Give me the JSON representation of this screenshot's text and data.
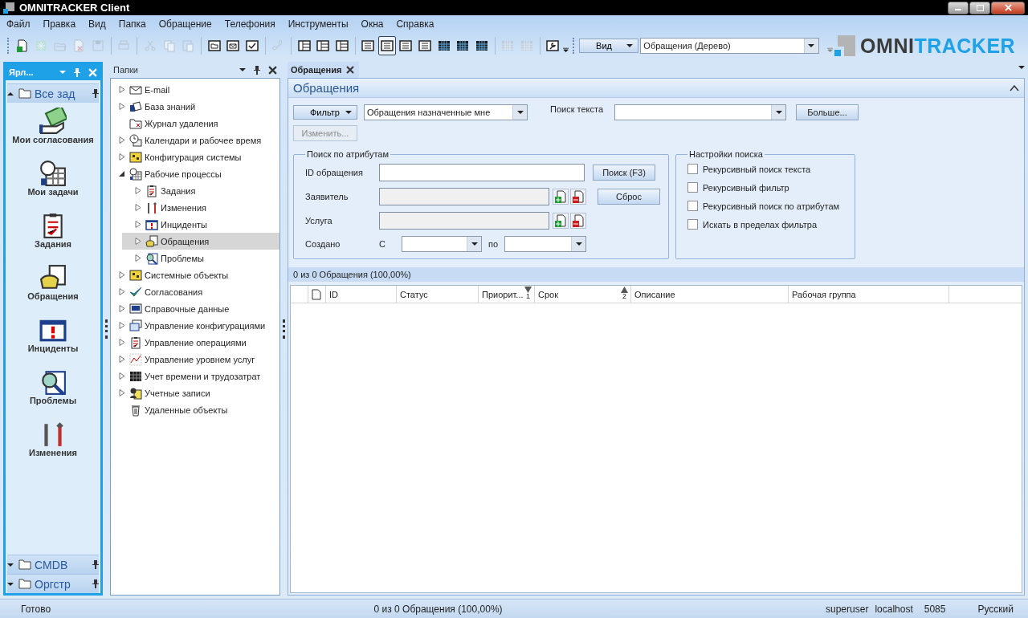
{
  "window": {
    "title": "OMNITRACKER Client"
  },
  "menu": [
    "Файл",
    "Правка",
    "Вид",
    "Папка",
    "Обращение",
    "Телефония",
    "Инструменты",
    "Окна",
    "Справка"
  ],
  "toolbar": [
    {
      "kind": "new",
      "disabled": false
    },
    {
      "kind": "star",
      "disabled": true
    },
    {
      "kind": "open",
      "disabled": true
    },
    {
      "kind": "delete",
      "disabled": true
    },
    {
      "kind": "save",
      "disabled": true
    },
    {
      "kind": "sep"
    },
    {
      "kind": "print",
      "disabled": true
    },
    {
      "kind": "sep"
    },
    {
      "kind": "cut",
      "disabled": true
    },
    {
      "kind": "copy",
      "disabled": true
    },
    {
      "kind": "paste",
      "disabled": true
    },
    {
      "kind": "sep"
    },
    {
      "kind": "folderwin",
      "disabled": false
    },
    {
      "kind": "mailwin",
      "disabled": false
    },
    {
      "kind": "checkwin",
      "disabled": false
    },
    {
      "kind": "sep"
    },
    {
      "kind": "phone",
      "disabled": true
    },
    {
      "kind": "sep"
    },
    {
      "kind": "layout",
      "disabled": false
    },
    {
      "kind": "layout",
      "disabled": false
    },
    {
      "kind": "layout",
      "disabled": false
    },
    {
      "kind": "sep"
    },
    {
      "kind": "list",
      "disabled": false
    },
    {
      "kind": "list",
      "disabled": false,
      "pressed": true
    },
    {
      "kind": "list",
      "disabled": false
    },
    {
      "kind": "list",
      "disabled": false
    },
    {
      "kind": "grid",
      "disabled": false
    },
    {
      "kind": "grid",
      "disabled": false
    },
    {
      "kind": "grid",
      "disabled": false
    },
    {
      "kind": "sep"
    },
    {
      "kind": "grid",
      "disabled": true
    },
    {
      "kind": "grid",
      "disabled": true
    },
    {
      "kind": "sep"
    },
    {
      "kind": "wrench",
      "disabled": false
    }
  ],
  "view_button": "Вид",
  "view_combo": "Обращения (Дерево)",
  "logo": {
    "dark": "OMNI",
    "accent": "TRACKER"
  },
  "shortcuts_panel": {
    "title": "Ярл...",
    "top_group": "Все зад",
    "items": [
      {
        "kind": "approval",
        "label": "Мои согласования"
      },
      {
        "kind": "calendar",
        "label": "Мои задачи"
      },
      {
        "kind": "clipboard",
        "label": "Задания"
      },
      {
        "kind": "phone",
        "label": "Обращения"
      },
      {
        "kind": "alert",
        "label": "Инциденты"
      },
      {
        "kind": "search",
        "label": "Проблемы"
      },
      {
        "kind": "tools",
        "label": "Изменения"
      }
    ],
    "bottom_groups": [
      "CMDB",
      "Оргстр"
    ]
  },
  "folders_panel": {
    "title": "Папки",
    "items": [
      {
        "kind": "mail",
        "label": "E-mail",
        "expandable": true,
        "expanded": false,
        "selected": false
      },
      {
        "kind": "book",
        "label": "База знаний",
        "expandable": true,
        "expanded": false,
        "selected": false
      },
      {
        "kind": "folderx",
        "label": "Журнал удаления",
        "expandable": false,
        "expanded": false,
        "selected": false
      },
      {
        "kind": "clock",
        "label": "Календари и рабочее время",
        "expandable": true,
        "expanded": false,
        "selected": false
      },
      {
        "kind": "config",
        "label": "Конфигурация системы",
        "expandable": true,
        "expanded": false,
        "selected": false
      },
      {
        "kind": "calendar",
        "label": "Рабочие процессы",
        "expandable": true,
        "expanded": true,
        "selected": false,
        "children": [
          {
            "kind": "clipboard",
            "label": "Задания",
            "expandable": true,
            "expanded": false,
            "selected": false
          },
          {
            "kind": "tools",
            "label": "Изменения",
            "expandable": true,
            "expanded": false,
            "selected": false
          },
          {
            "kind": "alert",
            "label": "Инциденты",
            "expandable": true,
            "expanded": false,
            "selected": false
          },
          {
            "kind": "phone",
            "label": "Обращения",
            "expandable": true,
            "expanded": false,
            "selected": true
          },
          {
            "kind": "search",
            "label": "Проблемы",
            "expandable": true,
            "expanded": false,
            "selected": false
          }
        ]
      },
      {
        "kind": "config",
        "label": "Системные объекты",
        "expandable": true,
        "expanded": false,
        "selected": false
      },
      {
        "kind": "check",
        "label": "Согласования",
        "expandable": true,
        "expanded": false,
        "selected": false
      },
      {
        "kind": "screen",
        "label": "Справочные данные",
        "expandable": true,
        "expanded": false,
        "selected": false
      },
      {
        "kind": "stack",
        "label": "Управление конфигурациями",
        "expandable": true,
        "expanded": false,
        "selected": false
      },
      {
        "kind": "clipboard",
        "label": "Управление операциями",
        "expandable": true,
        "expanded": false,
        "selected": false
      },
      {
        "kind": "chart",
        "label": "Управление уровнем услуг",
        "expandable": true,
        "expanded": false,
        "selected": false
      },
      {
        "kind": "grid",
        "label": "Учет времени и трудозатрат",
        "expandable": true,
        "expanded": false,
        "selected": false
      },
      {
        "kind": "users",
        "label": "Учетные записи",
        "expandable": true,
        "expanded": false,
        "selected": false
      },
      {
        "kind": "trash",
        "label": "Удаленные объекты",
        "expandable": false,
        "expanded": false,
        "selected": false
      }
    ]
  },
  "tabs": [
    {
      "label": "Обращения",
      "selected": true
    }
  ],
  "view": {
    "title": "Обращения",
    "filter_button": "Фильтр",
    "filter_combo": "Обращения назначенные мне",
    "text_search_label": "Поиск текста",
    "more_button": "Больше...",
    "edit_button": {
      "label": "Изменить...",
      "disabled": true
    },
    "attribute_search": {
      "title": "Поиск по атрибутам",
      "id_label": "ID обращения",
      "requester_label": "Заявитель",
      "service_label": "Услуга",
      "created_label": "Создано",
      "from_label": "С",
      "to_label": "по",
      "search_button": "Поиск (F3)",
      "reset_button": "Сброс"
    },
    "search_settings": {
      "title": "Настройки поиска",
      "options": [
        {
          "label": "Рекурсивный поиск текста",
          "checked": false
        },
        {
          "label": "Рекурсивный фильтр",
          "checked": false
        },
        {
          "label": "Рекурсивный поиск по атрибутам",
          "checked": false
        },
        {
          "label": "Искать в пределах фильтра",
          "checked": false
        }
      ]
    },
    "count": "0 из 0 Обращения (100,00%)",
    "columns": [
      {
        "label": "ID",
        "sorted": false
      },
      {
        "label": "Статус",
        "sorted": false
      },
      {
        "label": "Приорит...",
        "sorted": true,
        "descending": true,
        "sort_index": "1"
      },
      {
        "label": "Срок",
        "sorted": true,
        "descending": false,
        "sort_index": "2"
      },
      {
        "label": "Описание",
        "sorted": false
      },
      {
        "label": "Рабочая группа",
        "sorted": false
      }
    ]
  },
  "status_bar": {
    "state": "Готово",
    "count": "0 из 0 Обращения (100,00%)",
    "user": "superuser",
    "host": "localhost",
    "port": "5085",
    "language": "Русский"
  }
}
